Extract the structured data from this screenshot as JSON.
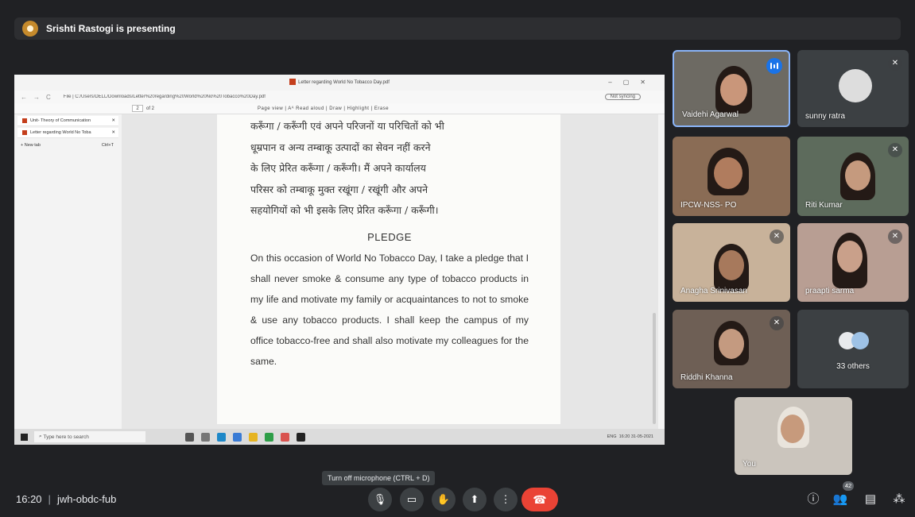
{
  "presenter": {
    "text": "Srishti Rastogi is presenting"
  },
  "browser": {
    "title": "Letter regarding World No Tobacco Day.pdf",
    "url": "File | C:/Users/DELL/Downloads/Letter%20regarding%20World%20No%20Tobacco%20Day.pdf",
    "sync": "Not syncing",
    "page_current": "2",
    "page_total": "of 2",
    "toolbar_items": "Page view  |  Aᴬ Read aloud  |  Draw  |  Highlight  |  Erase",
    "tabs": [
      {
        "label": "Unit- Theory of Communication"
      },
      {
        "label": "Letter regarding World No Toba"
      }
    ],
    "new_tab": "New tab",
    "new_tab_key": "Ctrl+T"
  },
  "document": {
    "hindi_lines": [
      "करूँगा / करूँगी एवं अपने परिजनों या परिचितों को भी",
      "धूम्रपान व अन्य तम्बाकू उत्पादों का सेवन नहीं करने",
      "के लिए प्रेरित करूँगा / करूँगी। मैं अपने कार्यालय",
      "परिसर को तम्बाकू मुक्त रखूंगा / रखूंगी और अपने",
      "सहयोगियों को भी इसके लिए प्रेरित करूँगा / करूँगी।"
    ],
    "pledge_heading": "PLEDGE",
    "pledge_text": "On this occasion of World No Tobacco Day, I take a pledge that I shall never smoke & consume any type of tobacco products in my life and motivate my family or acquaintances to not to smoke & use any tobacco products. I shall keep the campus of my office tobacco-free and shall also motivate my colleagues for the same."
  },
  "taskbar": {
    "search_placeholder": "Type here to search",
    "lang": "ENG",
    "time": "16:20",
    "date": "31-05-2021"
  },
  "participants": [
    {
      "name": "Vaidehi Agarwal",
      "state": "speaking"
    },
    {
      "name": "sunny ratra",
      "state": "muted"
    },
    {
      "name": "IPCW-NSS- PO",
      "state": "unmuted"
    },
    {
      "name": "Riti Kumar",
      "state": "muted"
    },
    {
      "name": "Anagha Srinivasan",
      "state": "muted"
    },
    {
      "name": "praapti sarma",
      "state": "muted"
    },
    {
      "name": "Riddhi Khanna",
      "state": "muted"
    },
    {
      "name": "33 others",
      "state": "group"
    },
    {
      "name": "You",
      "state": "self"
    }
  ],
  "meeting": {
    "time": "16:20",
    "code": "jwh-obdc-fub",
    "tooltip": "Turn off microphone (CTRL + D)",
    "people_count": "42"
  },
  "colors": {
    "background": "#202124",
    "hangup": "#ea4335",
    "speaking": "#1a73e8",
    "tile": "#3c4043"
  }
}
